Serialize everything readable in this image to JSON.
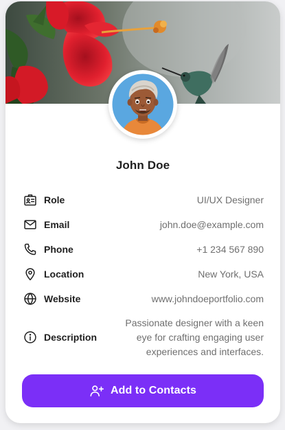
{
  "profile": {
    "name": "John Doe"
  },
  "details": [
    {
      "label": "Role",
      "value": "UI/UX Designer",
      "icon": "id-card-icon"
    },
    {
      "label": "Email",
      "value": "john.doe@example.com",
      "icon": "mail-icon"
    },
    {
      "label": "Phone",
      "value": "+1 234 567 890",
      "icon": "phone-icon"
    },
    {
      "label": "Location",
      "value": "New York, USA",
      "icon": "location-pin-icon"
    },
    {
      "label": "Website",
      "value": "www.johndoeportfolio.com",
      "icon": "globe-icon"
    },
    {
      "label": "Description",
      "value": "Passionate designer with a keen eye for crafting engaging user experiences and interfaces.",
      "icon": "info-icon"
    }
  ],
  "action": {
    "label": "Add to Contacts",
    "icon": "add-user-icon"
  },
  "colors": {
    "accent": "#7b2ff7",
    "card": "#ffffff",
    "background": "#f1f1f4",
    "label": "#1f1f1f",
    "value": "#6f6f6f"
  }
}
